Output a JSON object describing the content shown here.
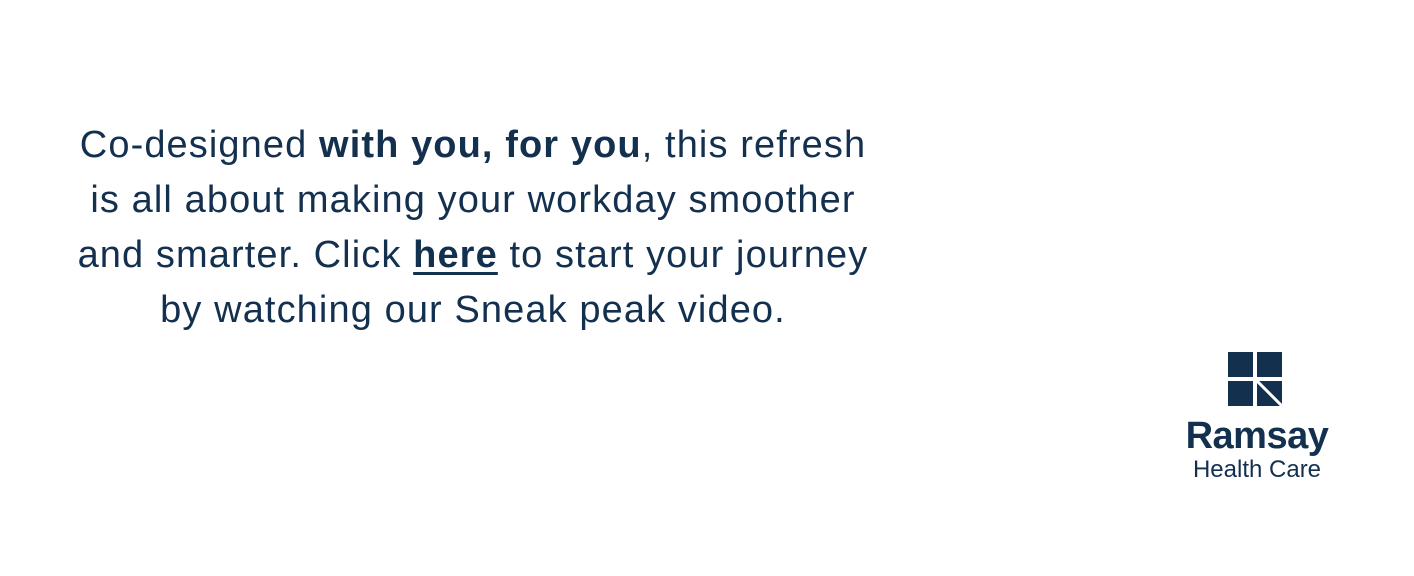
{
  "message": {
    "line1_pre": "Co-designed ",
    "line1_bold": "with you, for you",
    "line1_post": ", this refresh",
    "line2": "is all about making your workday smoother",
    "line3_pre": "and smarter. Click ",
    "link_text": "here",
    "line3_post": " to start your journey",
    "line4": "by watching our Sneak peak video."
  },
  "logo": {
    "name": "Ramsay",
    "subtitle": "Health Care",
    "icon": "ramsay-quad-square-icon",
    "color": "#13304f"
  },
  "colors": {
    "text": "#13304f",
    "background": "#ffffff"
  }
}
